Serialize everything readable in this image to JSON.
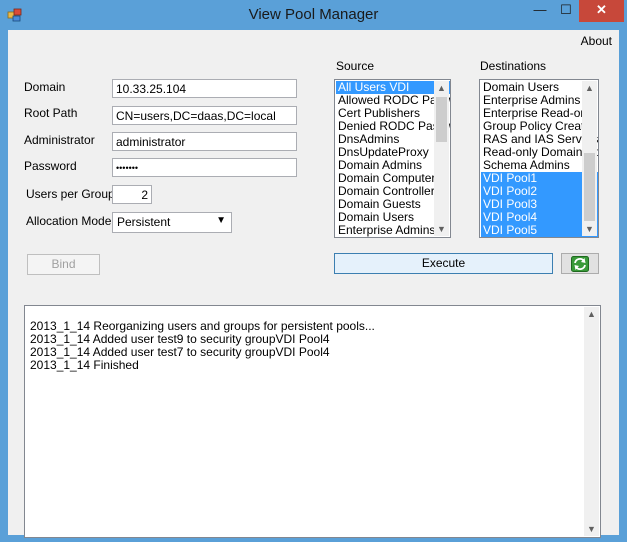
{
  "window": {
    "title": "View Pool Manager",
    "minimize_glyph": "—",
    "maximize_glyph": "☐",
    "close_glyph": "✕",
    "icon": "app-icon"
  },
  "menu": {
    "about": "About"
  },
  "form": {
    "domain_label": "Domain",
    "domain_value": "10.33.25.104",
    "root_path_label": "Root Path",
    "root_path_value": "CN=users,DC=daas,DC=local",
    "administrator_label": "Administrator",
    "administrator_value": "administrator",
    "password_label": "Password",
    "password_value": "•••••••",
    "users_per_group_label": "Users per Group",
    "users_per_group_value": "2",
    "allocation_model_label": "Allocation Model",
    "allocation_model_value": "Persistent",
    "bind_label": "Bind"
  },
  "source": {
    "label": "Source",
    "items": [
      {
        "text": "All Users VDI",
        "selected": true
      },
      {
        "text": "Allowed RODC Password Replication Group",
        "selected": false
      },
      {
        "text": "Cert Publishers",
        "selected": false
      },
      {
        "text": "Denied RODC Password Replication Group",
        "selected": false
      },
      {
        "text": "DnsAdmins",
        "selected": false
      },
      {
        "text": "DnsUpdateProxy",
        "selected": false
      },
      {
        "text": "Domain Admins",
        "selected": false
      },
      {
        "text": "Domain Computers",
        "selected": false
      },
      {
        "text": "Domain Controllers",
        "selected": false
      },
      {
        "text": "Domain Guests",
        "selected": false
      },
      {
        "text": "Domain Users",
        "selected": false
      },
      {
        "text": "Enterprise Admins",
        "selected": false
      }
    ]
  },
  "destinations": {
    "label": "Destinations",
    "items": [
      {
        "text": "Domain Users",
        "selected": false
      },
      {
        "text": "Enterprise Admins",
        "selected": false
      },
      {
        "text": "Enterprise Read-only Domain Controllers",
        "selected": false
      },
      {
        "text": "Group Policy Creator Owners",
        "selected": false
      },
      {
        "text": "RAS and IAS Servers",
        "selected": false
      },
      {
        "text": "Read-only Domain Controllers",
        "selected": false
      },
      {
        "text": "Schema Admins",
        "selected": false
      },
      {
        "text": "VDI Pool1",
        "selected": true
      },
      {
        "text": "VDI Pool2",
        "selected": true
      },
      {
        "text": "VDI Pool3",
        "selected": true
      },
      {
        "text": "VDI Pool4",
        "selected": true
      },
      {
        "text": "VDI Pool5",
        "selected": true
      }
    ]
  },
  "actions": {
    "execute_label": "Execute",
    "refresh_icon": "refresh-icon"
  },
  "log": {
    "lines": [
      "2013_1_14 Reorganizing users and groups for persistent pools...",
      "2013_1_14 Added user test9 to security groupVDI Pool4",
      "2013_1_14 Added user test7 to security groupVDI Pool4",
      "2013_1_14 Finished"
    ]
  },
  "colors": {
    "title_bar": "#5aa0d8",
    "close_button": "#c7483a",
    "selection": "#3399ff"
  }
}
